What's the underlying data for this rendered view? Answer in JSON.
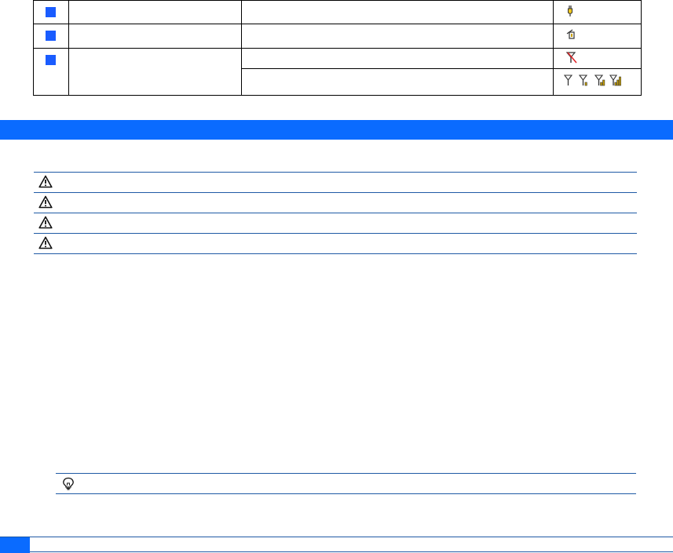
{
  "status_table": {
    "rows": [
      {
        "name": "",
        "description": "",
        "icon": "plug-connector-icon"
      },
      {
        "name": "",
        "description": "",
        "icon": "sim-tray-icon"
      },
      {
        "name": "",
        "description": "",
        "icon": "no-signal-antenna-icon"
      },
      {
        "description": "",
        "icons": [
          "signal-strength-0-icon",
          "signal-strength-1-icon",
          "signal-strength-2-icon",
          "signal-strength-3-icon"
        ]
      }
    ]
  },
  "section": {
    "title": ""
  },
  "warnings": [
    {
      "icon": "warning-triangle-icon",
      "text": ""
    },
    {
      "icon": "warning-triangle-icon",
      "text": ""
    },
    {
      "icon": "warning-triangle-icon",
      "text": ""
    },
    {
      "icon": "warning-triangle-icon",
      "text": ""
    }
  ],
  "tip": {
    "icon": "lightbulb-tip-icon",
    "text": ""
  },
  "footer": {
    "page_number": ""
  },
  "colors": {
    "accent_blue": "#0a6bff",
    "marker_blue": "#1a5cff",
    "rule_blue": "#1f5aa5",
    "icon_gold": "#c8a000",
    "icon_red": "#e0262a"
  }
}
